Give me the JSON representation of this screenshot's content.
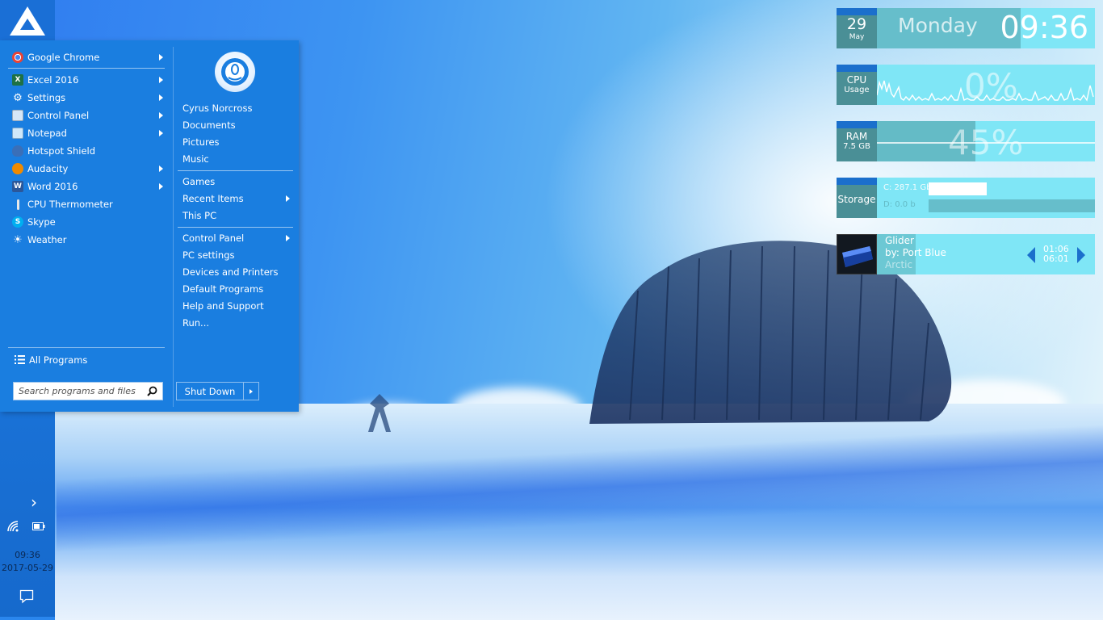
{
  "start_menu": {
    "programs": [
      {
        "label": "Google Chrome",
        "icon": "chrome-icon",
        "has_submenu": true
      },
      {
        "label": "Excel 2016",
        "icon": "excel-icon",
        "has_submenu": true
      },
      {
        "label": "Settings",
        "icon": "gear-icon",
        "has_submenu": true
      },
      {
        "label": "Control Panel",
        "icon": "control-panel-icon",
        "has_submenu": true
      },
      {
        "label": "Notepad",
        "icon": "notepad-icon",
        "has_submenu": true
      },
      {
        "label": "Hotspot Shield",
        "icon": "shield-icon",
        "has_submenu": false
      },
      {
        "label": "Audacity",
        "icon": "audacity-icon",
        "has_submenu": true
      },
      {
        "label": "Word 2016",
        "icon": "word-icon",
        "has_submenu": true
      },
      {
        "label": "CPU Thermometer",
        "icon": "thermometer-icon",
        "has_submenu": false
      },
      {
        "label": "Skype",
        "icon": "skype-icon",
        "has_submenu": false
      },
      {
        "label": "Weather",
        "icon": "weather-icon",
        "has_submenu": false
      }
    ],
    "all_programs_label": "All Programs",
    "search_placeholder": "Search programs and files",
    "user_name": "Cyrus Norcross",
    "places": [
      {
        "label": "Documents"
      },
      {
        "label": "Pictures"
      },
      {
        "label": "Music"
      },
      {
        "label": "Games"
      },
      {
        "label": "Recent Items",
        "has_submenu": true
      },
      {
        "label": "This PC"
      },
      {
        "label": "Control Panel",
        "has_submenu": true
      },
      {
        "label": "PC settings"
      },
      {
        "label": "Devices and Printers"
      },
      {
        "label": "Default Programs"
      },
      {
        "label": "Help and Support"
      },
      {
        "label": "Run..."
      }
    ],
    "shutdown_label": "Shut Down"
  },
  "taskbar": {
    "time": "09:36",
    "date": "2017-05-29"
  },
  "widgets": {
    "date": {
      "day": "29",
      "month": "May",
      "weekday": "Monday",
      "time": "09:36"
    },
    "cpu": {
      "label": "CPU",
      "sublabel": "Usage",
      "percent": "0%"
    },
    "ram": {
      "label": "RAM",
      "sublabel": "7.5 GB",
      "percent": "45%",
      "fill_fraction": 0.45
    },
    "storage": {
      "label": "Storage",
      "drives": [
        {
          "label": "C: 287.1 Gb",
          "used_fraction": 0.35
        },
        {
          "label": "D: 0.0 b",
          "used_fraction": 1.0
        }
      ]
    },
    "music": {
      "title": "Glider",
      "artist": "by: Port Blue",
      "album": "Arctic",
      "elapsed": "01:06",
      "total": "06:01"
    }
  },
  "colors": {
    "accent": "#1a7ee0",
    "widget_tile": "#4a8f96",
    "widget_body": "#7fe6f6",
    "tile_strip": "#1b6fcc"
  }
}
